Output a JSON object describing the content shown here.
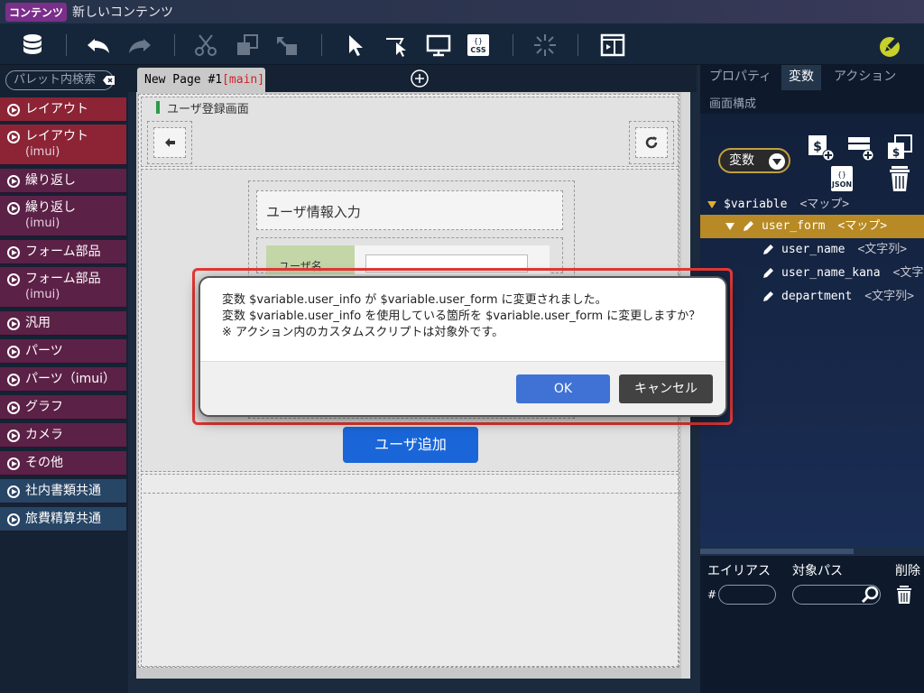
{
  "titlebar": {
    "badge": "コンテンツ",
    "title": "新しいコンテンツ"
  },
  "toolbar": {
    "icons": [
      "database-icon",
      "undo-icon",
      "redo-icon",
      "cut-icon",
      "copy-icon",
      "paste-icon",
      "pointer-icon",
      "select-icon",
      "preview-icon",
      "css-icon",
      "loading-icon",
      "panel-icon",
      "edit-icon"
    ]
  },
  "palette": {
    "search_placeholder": "パレット内検索",
    "items": [
      {
        "label": "レイアウト",
        "sub": "",
        "color": "red"
      },
      {
        "label": "レイアウト",
        "sub": "(imui)",
        "color": "red"
      },
      {
        "label": "繰り返し",
        "sub": "",
        "color": "purple"
      },
      {
        "label": "繰り返し",
        "sub": "(imui)",
        "color": "purple"
      },
      {
        "label": "フォーム部品",
        "sub": "",
        "color": "purple"
      },
      {
        "label": "フォーム部品",
        "sub": "(imui)",
        "color": "purple"
      },
      {
        "label": "汎用",
        "sub": "",
        "color": "purple"
      },
      {
        "label": "パーツ",
        "sub": "",
        "color": "purple"
      },
      {
        "label": "パーツ（imui）",
        "sub": "",
        "color": "purple"
      },
      {
        "label": "グラフ",
        "sub": "",
        "color": "purple"
      },
      {
        "label": "カメラ",
        "sub": "",
        "color": "purple"
      },
      {
        "label": "その他",
        "sub": "",
        "color": "purple"
      },
      {
        "label": "社内書類共通",
        "sub": "",
        "color": "blue"
      },
      {
        "label": "旅費精算共通",
        "sub": "",
        "color": "blue"
      }
    ]
  },
  "tab": {
    "name": "New Page #1",
    "main": "[main]"
  },
  "canvas": {
    "screen_title": "ユーザ登録画面",
    "box_title": "ユーザ情報入力",
    "field_label": "ユーザ名",
    "add_button": "ユーザ追加"
  },
  "right": {
    "tabs": [
      "プロパティ",
      "変数",
      "アクション"
    ],
    "active_tab": "変数",
    "sub": "画面構成",
    "select_value": "変数",
    "tree": [
      {
        "key": "$variable",
        "type": "<マップ>",
        "level": 0,
        "kind": "root",
        "selected": false
      },
      {
        "key": "user_form",
        "type": "<マップ>",
        "level": 1,
        "kind": "map",
        "selected": true
      },
      {
        "key": "user_name",
        "type": "<文字列>",
        "level": 2,
        "kind": "leaf",
        "selected": false
      },
      {
        "key": "user_name_kana",
        "type": "<文字列>",
        "level": 2,
        "kind": "leaf",
        "selected": false
      },
      {
        "key": "department",
        "type": "<文字列>",
        "level": 2,
        "kind": "leaf",
        "selected": false
      }
    ],
    "alias": {
      "h1": "エイリアス",
      "h2": "対象パス",
      "h3": "削除",
      "hash": "#"
    }
  },
  "dialog": {
    "line1": "変数 $variable.user_info が $variable.user_form に変更されました。",
    "line2": "変数 $variable.user_info を使用している箇所を $variable.user_form に変更しますか？",
    "line3": "※ アクション内のカスタムスクリプトは対象外です。",
    "ok": "OK",
    "cancel": "キャンセル"
  }
}
